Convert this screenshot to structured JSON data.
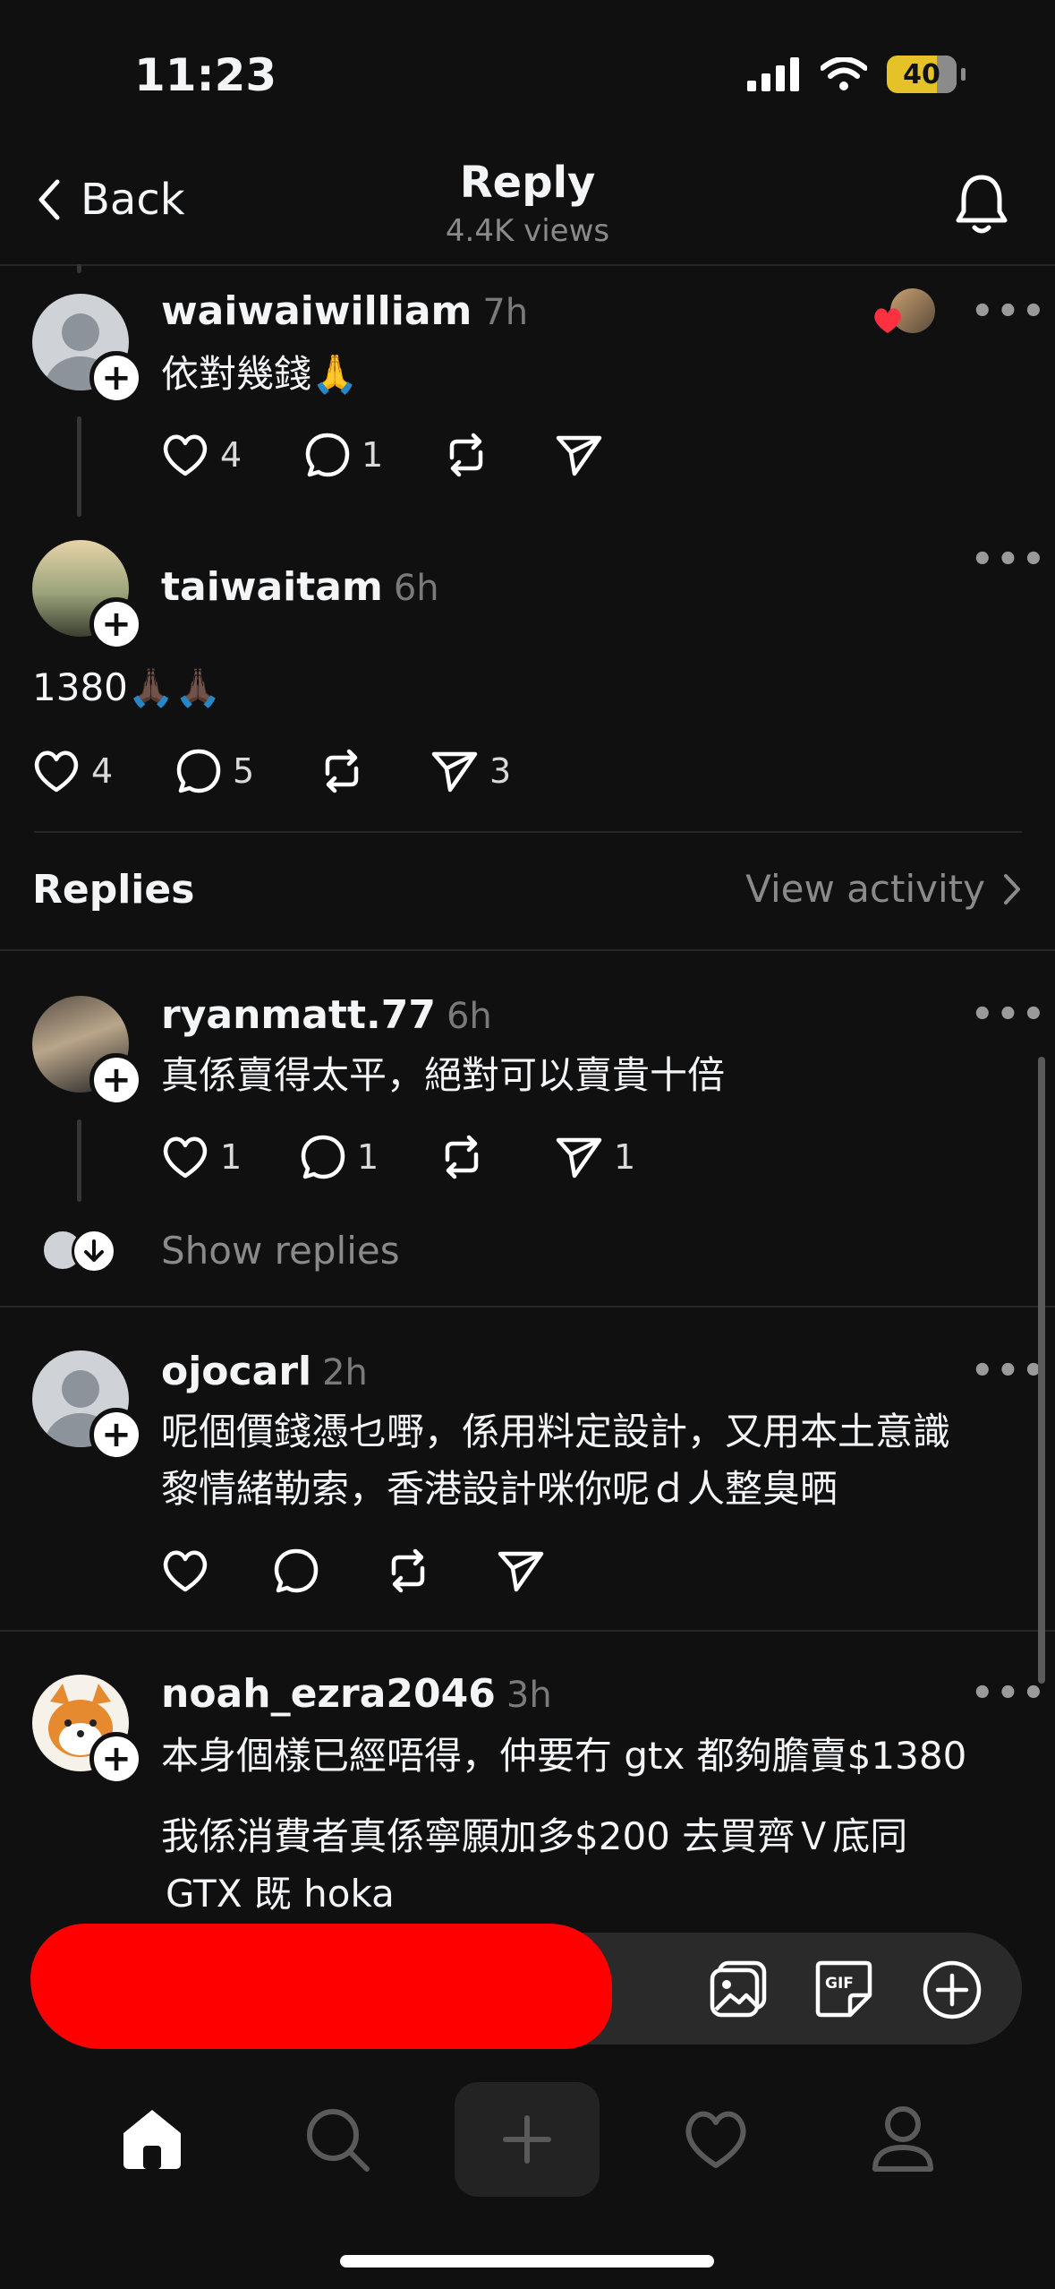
{
  "status_bar": {
    "time": "11:23",
    "battery": "40"
  },
  "nav": {
    "back_label": "Back",
    "title": "Reply",
    "subtitle": "4.4K views"
  },
  "posts": [
    {
      "username": "waiwaiwilliam",
      "time": "7h",
      "text": "依對幾錢🙏",
      "likes": "4",
      "comments": "1",
      "reposts": "",
      "shares": ""
    },
    {
      "username": "taiwaitam",
      "time": "6h",
      "text": "1380🙏🏿🙏🏿",
      "likes": "4",
      "comments": "5",
      "reposts": "",
      "shares": "3"
    }
  ],
  "replies_section": {
    "title": "Replies",
    "view_activity": "View activity"
  },
  "replies": [
    {
      "username": "ryanmatt.77",
      "time": "6h",
      "text": "真係賣得太平，絕對可以賣貴十倍",
      "likes": "1",
      "comments": "1",
      "reposts": "",
      "shares": "1",
      "show_replies": "Show replies"
    },
    {
      "username": "ojocarl",
      "time": "2h",
      "text_line1": "呢個價錢憑乜嘢，係用料定設計，又用本土意識",
      "text_line2": "黎情緒勒索，香港設計咪你呢ｄ人整臭晒"
    },
    {
      "username": "noah_ezra2046",
      "time": "3h",
      "text_line1": "本身個樣已經唔得，仲要冇 gtx 都夠膽賣$1380",
      "text_line2": "我係消費者真係寧願加多$200 去買齊Ｖ底同",
      "text_line3": "GTX 既 hoka"
    }
  ],
  "composer": {
    "icons": [
      "image-icon",
      "gif-icon",
      "plus-circle-icon"
    ]
  },
  "tabbar": {
    "icons": [
      "home-icon",
      "search-icon",
      "new-post-icon",
      "heart-icon",
      "profile-icon"
    ]
  },
  "colors": {
    "background": "#101010",
    "text": "#f3f5f7",
    "muted": "#8a8a8a",
    "like_red": "#ff3040",
    "battery": "#e6c229"
  }
}
